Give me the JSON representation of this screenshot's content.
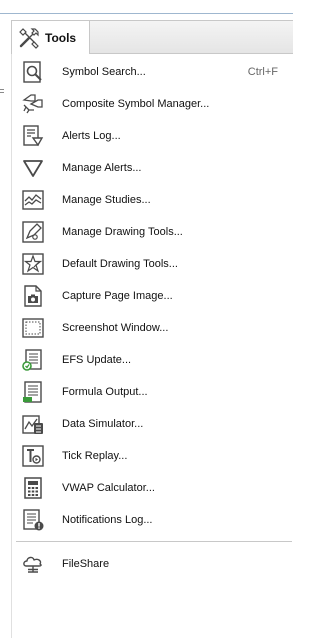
{
  "tab": {
    "label": "Tools",
    "icon": "tools-icon"
  },
  "menu": {
    "items": [
      {
        "label": "Symbol Search...",
        "shortcut": "Ctrl+F",
        "icon": "symbol-search-icon"
      },
      {
        "label": "Composite Symbol Manager...",
        "shortcut": "",
        "icon": "composite-symbol-icon"
      },
      {
        "label": "Alerts Log...",
        "shortcut": "",
        "icon": "alerts-log-icon"
      },
      {
        "label": "Manage Alerts...",
        "shortcut": "",
        "icon": "manage-alerts-icon"
      },
      {
        "label": "Manage Studies...",
        "shortcut": "",
        "icon": "manage-studies-icon"
      },
      {
        "label": "Manage Drawing Tools...",
        "shortcut": "",
        "icon": "manage-drawing-tools-icon"
      },
      {
        "label": "Default Drawing Tools...",
        "shortcut": "",
        "icon": "default-drawing-tools-icon"
      },
      {
        "label": "Capture Page Image...",
        "shortcut": "",
        "icon": "camera-icon"
      },
      {
        "label": "Screenshot Window...",
        "shortcut": "",
        "icon": "screenshot-window-icon"
      },
      {
        "label": "EFS Update...",
        "shortcut": "",
        "icon": "efs-update-icon"
      },
      {
        "label": "Formula Output...",
        "shortcut": "",
        "icon": "formula-output-icon"
      },
      {
        "label": "Data Simulator...",
        "shortcut": "",
        "icon": "data-simulator-icon"
      },
      {
        "label": "Tick Replay...",
        "shortcut": "",
        "icon": "tick-replay-icon"
      },
      {
        "label": "VWAP Calculator...",
        "shortcut": "",
        "icon": "calculator-icon"
      },
      {
        "label": "Notifications Log...",
        "shortcut": "",
        "icon": "notifications-log-icon"
      },
      {
        "label": "FileShare",
        "shortcut": "",
        "icon": "fileshare-icon"
      }
    ]
  },
  "colors": {
    "icon_stroke": "#4a4a4a",
    "accent_orange": "#e07b1a",
    "accent_green": "#3a9a3a",
    "header_border": "#9fb7cf"
  }
}
